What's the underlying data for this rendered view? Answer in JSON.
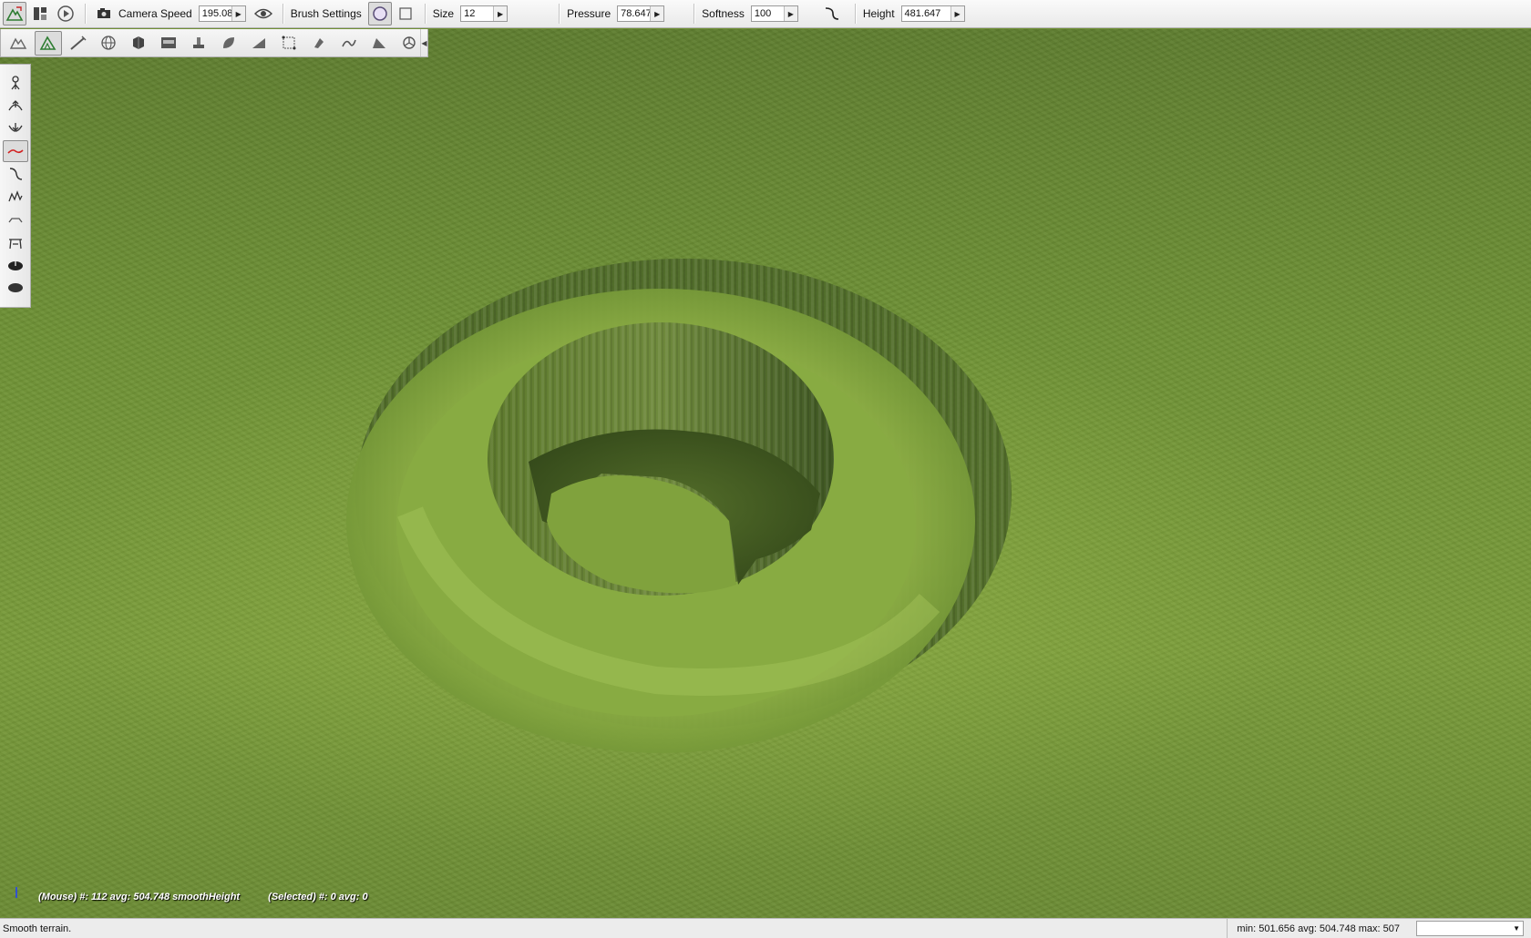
{
  "toolbar": {
    "camera_speed_label": "Camera Speed",
    "camera_speed_value": "195.08",
    "brush_settings_label": "Brush Settings",
    "size_label": "Size",
    "size_value": "12",
    "pressure_label": "Pressure",
    "pressure_value": "78.647",
    "softness_label": "Softness",
    "softness_value": "100",
    "height_label": "Height",
    "height_value": "481.647",
    "icons": [
      "terrain-editor-icon",
      "layout-icon",
      "play-icon",
      "camera-icon",
      "visibility-eye-icon",
      "brush-circle-icon",
      "brush-square-icon",
      "softness-curve-icon"
    ]
  },
  "tool_palette": {
    "icons": [
      "select-terrain-icon",
      "terrain-paint-icon",
      "road-pencil-icon",
      "globe-icon",
      "cube-icon",
      "data-block-icon",
      "stamp-icon",
      "leaf-icon",
      "ramp-icon",
      "bounds-icon",
      "brush-fill-icon",
      "wave-icon",
      "slope-icon",
      "gizmo-icon"
    ],
    "active_index": 1
  },
  "brush_palette": {
    "icons": [
      "dig-tool-icon",
      "raise-height-icon",
      "lower-height-icon",
      "smooth-height-icon",
      "paint-curve-icon",
      "noise-icon",
      "flatten-icon",
      "set-height-icon",
      "clear-terrain-icon",
      "restore-terrain-icon"
    ],
    "active_index": 3
  },
  "hud": {
    "mouse_info": "(Mouse) #: 112  avg: 504.748  smoothHeight",
    "selected_info": "(Selected) #: 0  avg: 0"
  },
  "status_bar": {
    "message": "Smooth terrain.",
    "stats": "min: 501.656  avg: 504.748  max: 507"
  },
  "colors": {
    "grass_base": "#6f9236",
    "crater_wall": "#4f6a2a",
    "active_tool_border": "#8a8a8a",
    "brush_red": "#d22020"
  }
}
